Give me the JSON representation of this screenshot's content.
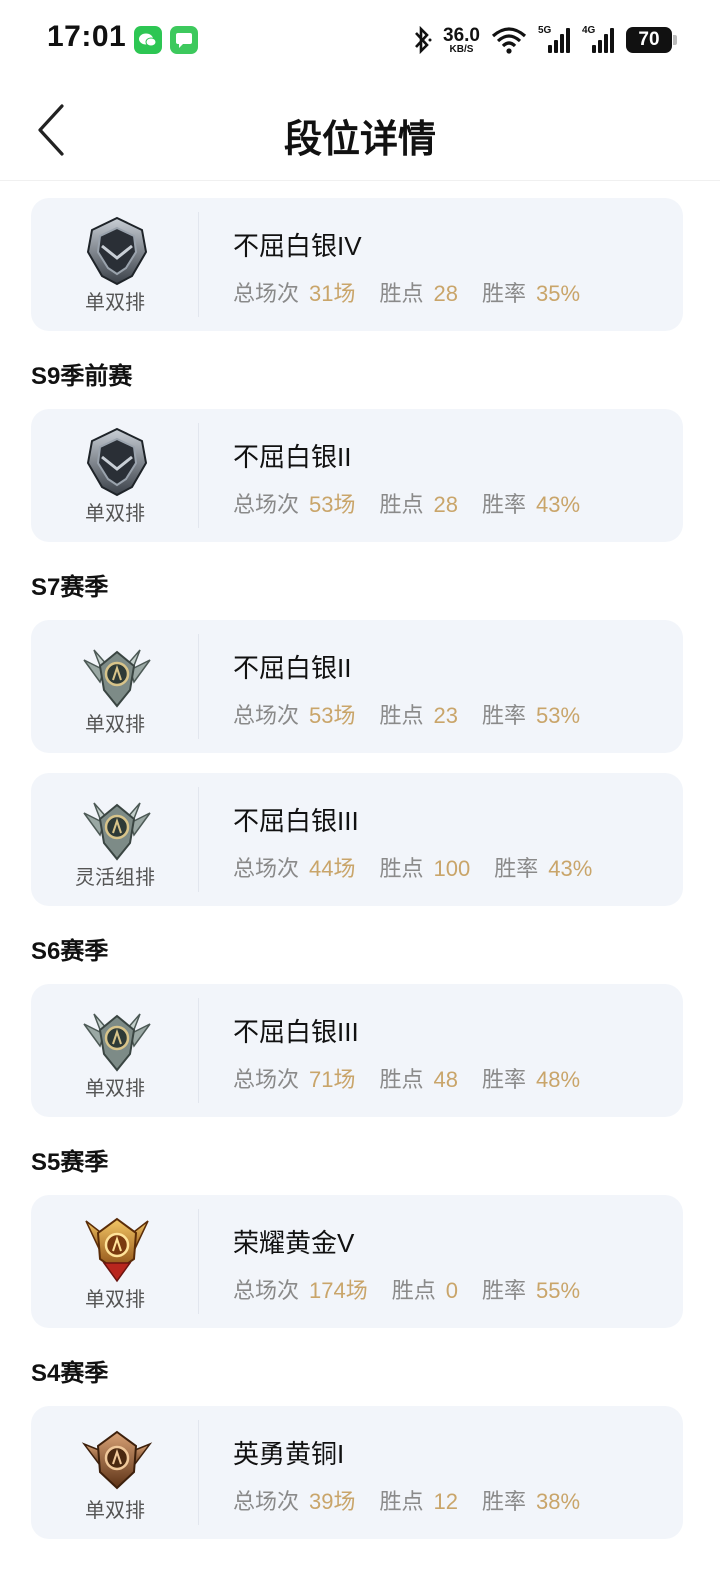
{
  "status_bar": {
    "time": "17:01",
    "net_speed": "36.0",
    "net_unit": "KB/S",
    "signal1": "5G",
    "signal2": "4G",
    "battery": "70"
  },
  "header": {
    "title": "段位详情"
  },
  "labels": {
    "total": "总场次",
    "points": "胜点",
    "winrate": "胜率"
  },
  "sections": [
    {
      "title": "",
      "cards": [
        {
          "queue": "单双排",
          "rank": "不屈白银IV",
          "badge": "silver-dark",
          "total": "31场",
          "points": "28",
          "winrate": "35%"
        }
      ]
    },
    {
      "title": "S9季前赛",
      "cards": [
        {
          "queue": "单双排",
          "rank": "不屈白银II",
          "badge": "silver-dark",
          "total": "53场",
          "points": "28",
          "winrate": "43%"
        }
      ]
    },
    {
      "title": "S7赛季",
      "cards": [
        {
          "queue": "单双排",
          "rank": "不屈白银II",
          "badge": "silver-wing",
          "total": "53场",
          "points": "23",
          "winrate": "53%"
        },
        {
          "queue": "灵活组排",
          "rank": "不屈白银III",
          "badge": "silver-wing",
          "total": "44场",
          "points": "100",
          "winrate": "43%"
        }
      ]
    },
    {
      "title": "S6赛季",
      "cards": [
        {
          "queue": "单双排",
          "rank": "不屈白银III",
          "badge": "silver-wing",
          "total": "71场",
          "points": "48",
          "winrate": "48%"
        }
      ]
    },
    {
      "title": "S5赛季",
      "cards": [
        {
          "queue": "单双排",
          "rank": "荣耀黄金V",
          "badge": "gold",
          "total": "174场",
          "points": "0",
          "winrate": "55%"
        }
      ]
    },
    {
      "title": "S4赛季",
      "cards": [
        {
          "queue": "单双排",
          "rank": "英勇黄铜I",
          "badge": "bronze",
          "total": "39场",
          "points": "12",
          "winrate": "38%"
        }
      ]
    }
  ]
}
